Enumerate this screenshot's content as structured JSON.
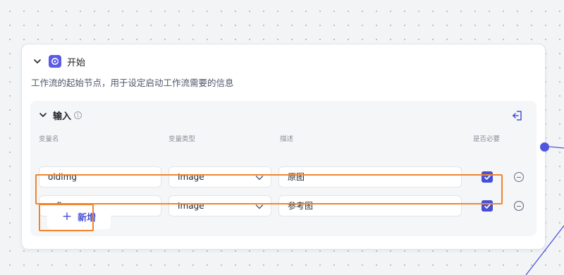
{
  "node": {
    "title": "开始",
    "description": "工作流的起始节点，用于设定启动工作流需要的信息"
  },
  "input_section": {
    "title": "输入",
    "columns": {
      "name": "变量名",
      "type": "变量类型",
      "desc": "描述",
      "required": "是否必要"
    },
    "rows": [
      {
        "name": "oldimg",
        "type": "Image",
        "desc": "原图",
        "required": true
      },
      {
        "name": "refimg",
        "type": "Image",
        "desc": "参考图",
        "required": true
      }
    ],
    "add_label": "新增"
  },
  "colors": {
    "accent": "#4650d6",
    "highlight": "#f0852d",
    "port": "#4f55e0"
  },
  "icons": {
    "node": "start-node-icon",
    "collapse": "chevron-down-icon",
    "info": "info-icon",
    "import": "import-variable-icon",
    "remove": "remove-circle-icon",
    "add": "plus-icon"
  }
}
